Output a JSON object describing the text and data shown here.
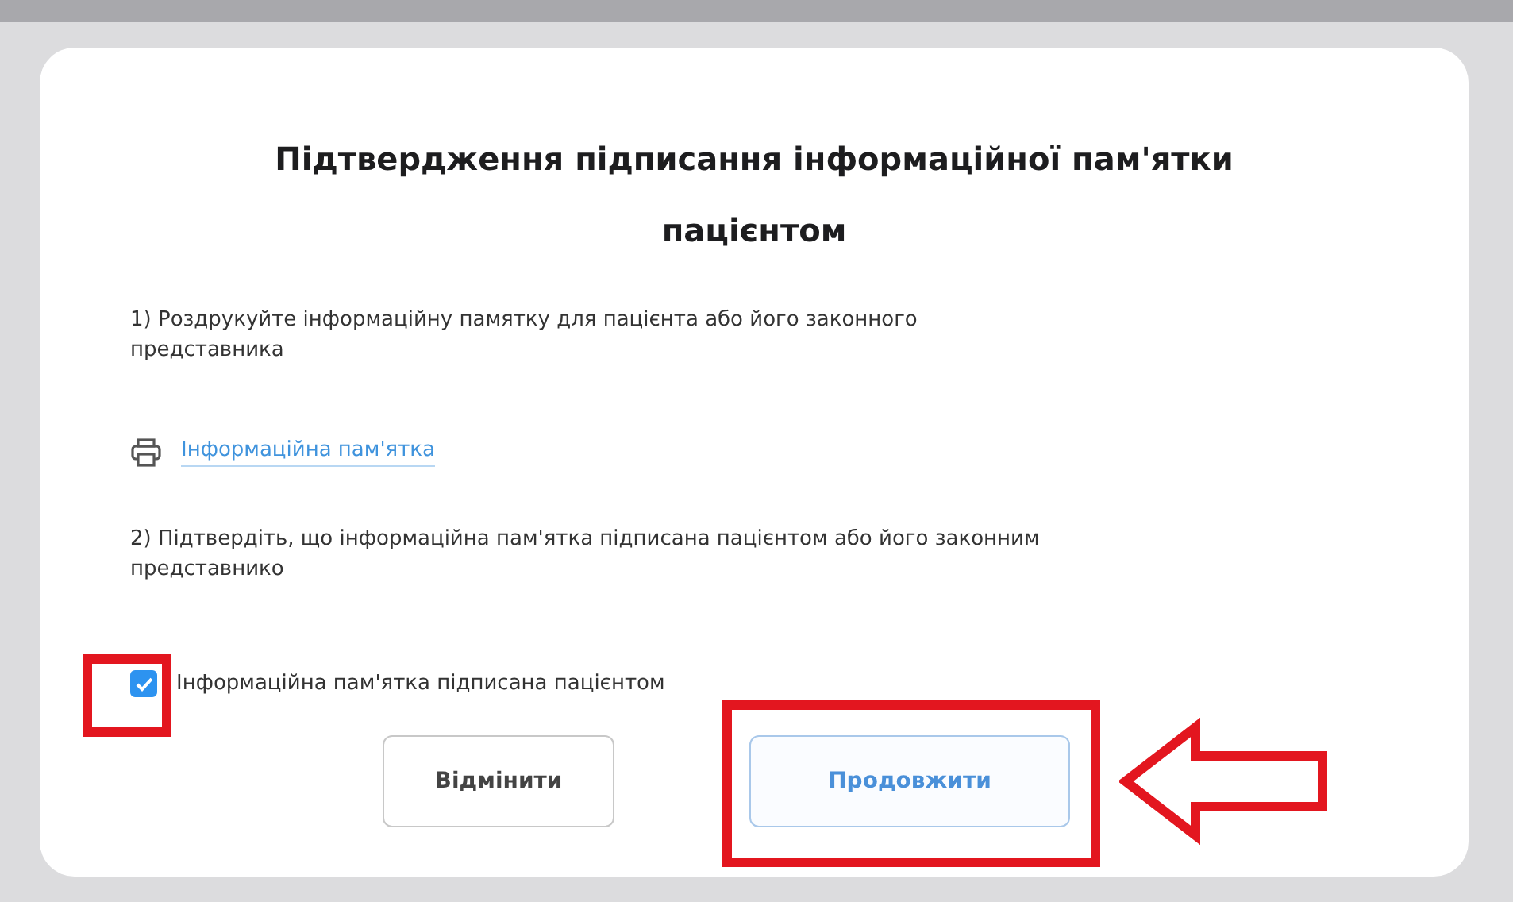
{
  "dialog": {
    "title": "Підтвердження підписання інформаційної пам'ятки пацієнтом",
    "step_1": "1) Роздрукуйте інформаційну памятку для пацієнта або його законного представника",
    "print_link": "Інформаційна пам'ятка",
    "step_2": "2) Підтвердіть, що інформаційна пам'ятка підписана пацієнтом або його законним представнико",
    "checkbox": {
      "label": "Інформаційна пам'ятка підписана пацієнтом",
      "checked": true
    },
    "buttons": [
      {
        "label": "Відмінити",
        "kind": "secondary"
      },
      {
        "label": "Продовжити",
        "kind": "primary"
      }
    ]
  }
}
